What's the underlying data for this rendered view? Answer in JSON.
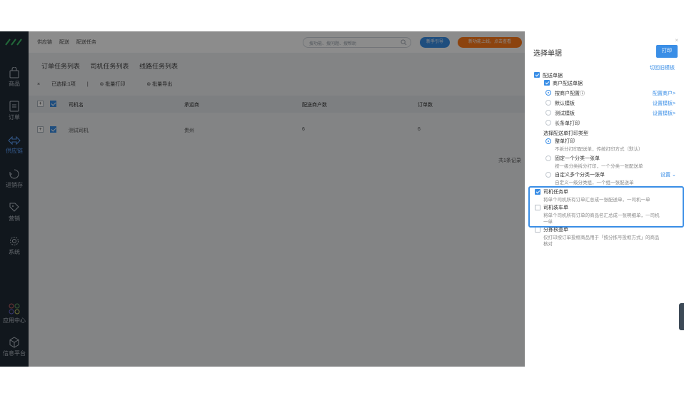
{
  "nav": {
    "items": [
      {
        "label": "商品",
        "icon": "bag-icon"
      },
      {
        "label": "订单",
        "icon": "order-icon"
      },
      {
        "label": "供应链",
        "icon": "supply-chain-icon",
        "active": true
      },
      {
        "label": "进销存",
        "icon": "inventory-icon"
      },
      {
        "label": "营销",
        "icon": "tag-icon"
      },
      {
        "label": "系统",
        "icon": "gear-icon"
      },
      {
        "label": "应用中心",
        "icon": "apps-icon"
      },
      {
        "label": "信息平台",
        "icon": "cube-icon"
      }
    ]
  },
  "topbar": {
    "breadcrumb": [
      "供应链",
      "配送",
      "配送任务"
    ],
    "search_placeholder": "搜功能、搜问题、搜帮助",
    "guide_label": "新手引导",
    "promo_label": "新功能上线，点击查看"
  },
  "tabs": [
    "订单任务列表",
    "司机任务列表",
    "线路任务列表"
  ],
  "bulk": {
    "close": "×",
    "selected": "已选择:1项",
    "divider": "|",
    "print": "批量打印",
    "export": "批量导出"
  },
  "table": {
    "headers": [
      "司机名",
      "承运商",
      "配送商户数",
      "订单数"
    ],
    "rows": [
      {
        "driver": "测试司机",
        "carrier": "贵州",
        "merchants": "6",
        "orders": "6"
      }
    ],
    "total": "共1条记录"
  },
  "drawer": {
    "close": "×",
    "title": "选择单据",
    "print_button": "打印",
    "switch_template": "切回旧模板",
    "delivery_doc": "配送单据",
    "merchant_delivery_doc": "商户配送单据",
    "options": [
      {
        "label": "按商户配置ⓘ",
        "action": "配置商户>",
        "selected": true
      },
      {
        "label": "默认模板",
        "action": "设置模板>",
        "selected": false
      },
      {
        "label": "测试模板",
        "action": "设置模板>",
        "selected": false
      },
      {
        "label": "长条单打印",
        "action": "",
        "selected": false
      }
    ],
    "print_type_title": "选择配送单打印类型",
    "print_types": [
      {
        "label": "整单打印",
        "desc": "不拆分打印配送单，传统打印方式（默认）",
        "selected": true
      },
      {
        "label": "固定一个分类一张单",
        "desc": "按一级分类拆分打印，一个分类一张配送单",
        "selected": false
      },
      {
        "label": "自定义多个分类一张单",
        "desc": "自定义一级分类组，一个组一张配送单",
        "selected": false,
        "action": "设置"
      }
    ],
    "driver_task": {
      "label": "司机任务单",
      "desc": "将单个司机所有订单汇总成一张配送单，一司机一单",
      "checked": true
    },
    "driver_loading": {
      "label": "司机装车单",
      "desc1": "将单个司机所有订单的商品名汇总成一张明细单，一司机",
      "desc2": "一单",
      "checked": false
    },
    "sorting_check": {
      "label": "分拣核查单",
      "desc1": "仅打印按订单投框商品用于「按分拣号投框方式」的商品",
      "desc2": "核对",
      "checked": false
    }
  },
  "colors": {
    "accent": "#3a8ee6",
    "nav_bg": "#1f2a36",
    "promo": "#ff7a1a"
  }
}
